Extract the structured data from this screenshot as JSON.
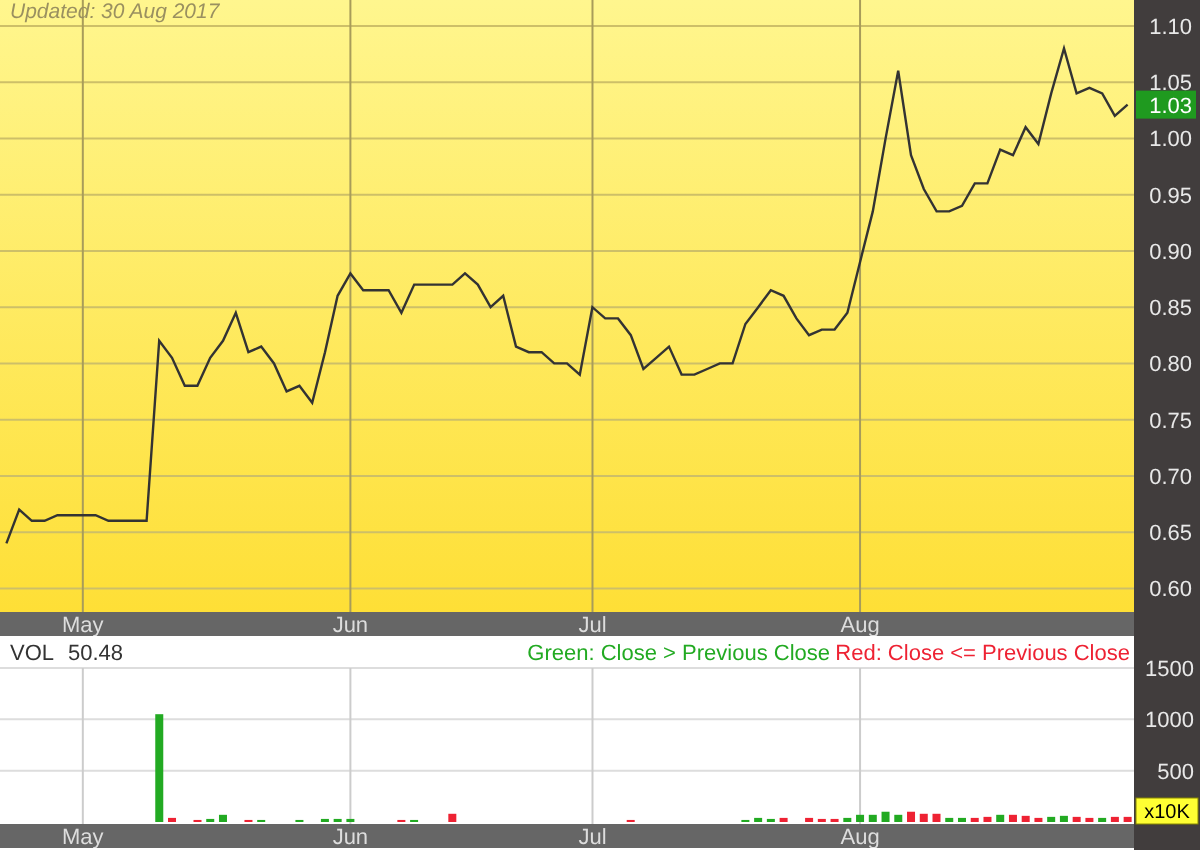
{
  "updated": "Updated: 30 Aug 2017",
  "price_chart": {
    "last_price": "1.03",
    "chart_data": {
      "type": "line",
      "categories": [
        null,
        null,
        null,
        null,
        null,
        null,
        "May",
        null,
        null,
        null,
        null,
        null,
        null,
        null,
        null,
        null,
        null,
        null,
        null,
        null,
        null,
        null,
        null,
        null,
        null,
        null,
        null,
        "Jun",
        null,
        null,
        null,
        null,
        null,
        null,
        null,
        null,
        null,
        null,
        null,
        null,
        null,
        null,
        null,
        null,
        null,
        null,
        "Jul",
        null,
        null,
        null,
        null,
        null,
        null,
        null,
        null,
        null,
        null,
        null,
        null,
        null,
        null,
        null,
        null,
        null,
        null,
        null,
        null,
        "Aug",
        null,
        null,
        null,
        null,
        null,
        null,
        null,
        null,
        null,
        null,
        null,
        null,
        null,
        null,
        null,
        null,
        null,
        null,
        null,
        null,
        null
      ],
      "series": [
        {
          "color": "#333333",
          "values": [
            0.64,
            0.67,
            0.66,
            0.66,
            0.665,
            0.665,
            0.665,
            0.665,
            0.66,
            0.66,
            0.66,
            0.66,
            0.82,
            0.805,
            0.78,
            0.78,
            0.805,
            0.82,
            0.845,
            0.81,
            0.815,
            0.8,
            0.775,
            0.78,
            0.765,
            0.81,
            0.86,
            0.88,
            0.865,
            0.865,
            0.865,
            0.845,
            0.87,
            0.87,
            0.87,
            0.87,
            0.88,
            0.87,
            0.85,
            0.86,
            0.815,
            0.81,
            0.81,
            0.8,
            0.8,
            0.79,
            0.85,
            0.84,
            0.84,
            0.825,
            0.795,
            0.805,
            0.815,
            0.79,
            0.79,
            0.795,
            0.8,
            0.8,
            0.835,
            0.85,
            0.865,
            0.86,
            0.84,
            0.825,
            0.83,
            0.83,
            0.845,
            0.89,
            0.935,
            1.0,
            1.06,
            0.985,
            0.955,
            0.935,
            0.935,
            0.94,
            0.96,
            0.96,
            0.99,
            0.985,
            1.01,
            0.995,
            1.04,
            1.08,
            1.04,
            1.045,
            1.04,
            1.02,
            1.03
          ]
        }
      ],
      "ylim": [
        0.579,
        1.123
      ],
      "grid": true,
      "yticks": [
        {
          "value": 0.6,
          "label": "0.60"
        },
        {
          "value": 0.65,
          "label": "0.65"
        },
        {
          "value": 0.7,
          "label": "0.70"
        },
        {
          "value": 0.75,
          "label": "0.75"
        },
        {
          "value": 0.8,
          "label": "0.80"
        },
        {
          "value": 0.85,
          "label": "0.85"
        },
        {
          "value": 0.9,
          "label": "0.90"
        },
        {
          "value": 0.95,
          "label": "0.95"
        },
        {
          "value": 1.0,
          "label": "1.00"
        },
        {
          "value": 1.05,
          "label": "1.05"
        },
        {
          "value": 1.1,
          "label": "1.10"
        }
      ]
    }
  },
  "volume_chart": {
    "label": "VOL",
    "reading": "50.48",
    "unit": "x10K",
    "chart_data": {
      "type": "bar",
      "categories": [
        null,
        null,
        null,
        null,
        null,
        null,
        "May",
        null,
        null,
        null,
        null,
        null,
        null,
        null,
        null,
        null,
        null,
        null,
        null,
        null,
        null,
        null,
        null,
        null,
        null,
        null,
        null,
        "Jun",
        null,
        null,
        null,
        null,
        null,
        null,
        null,
        null,
        null,
        null,
        null,
        null,
        null,
        null,
        null,
        null,
        null,
        null,
        "Jul",
        null,
        null,
        null,
        null,
        null,
        null,
        null,
        null,
        null,
        null,
        null,
        null,
        null,
        null,
        null,
        null,
        null,
        null,
        null,
        null,
        "Aug",
        null,
        null,
        null,
        null,
        null,
        null,
        null,
        null,
        null,
        null,
        null,
        null,
        null,
        null,
        null,
        null,
        null,
        null,
        null,
        null,
        null
      ],
      "series": [
        {
          "name": "Green: Close > Previous Close",
          "color": "#22aa22",
          "values": [
            null,
            null,
            null,
            null,
            null,
            null,
            null,
            null,
            null,
            null,
            null,
            null,
            1050,
            null,
            null,
            null,
            30,
            70,
            null,
            null,
            20,
            null,
            null,
            20,
            null,
            30,
            30,
            30,
            null,
            null,
            null,
            null,
            20,
            null,
            null,
            null,
            null,
            null,
            null,
            null,
            null,
            null,
            null,
            null,
            null,
            null,
            null,
            null,
            null,
            null,
            null,
            null,
            null,
            null,
            null,
            null,
            null,
            null,
            20,
            40,
            30,
            null,
            null,
            null,
            null,
            null,
            40,
            70,
            70,
            100,
            70,
            null,
            null,
            null,
            40,
            40,
            null,
            null,
            70,
            null,
            null,
            null,
            50,
            60,
            null,
            null,
            40,
            null,
            null
          ]
        },
        {
          "name": "Red: Close <= Previous Close",
          "color": "#ee2233",
          "values": [
            null,
            null,
            null,
            null,
            null,
            null,
            null,
            null,
            null,
            null,
            null,
            null,
            null,
            40,
            null,
            20,
            null,
            null,
            null,
            20,
            null,
            null,
            null,
            null,
            null,
            null,
            null,
            null,
            null,
            null,
            null,
            20,
            null,
            null,
            null,
            80,
            null,
            null,
            null,
            null,
            null,
            null,
            null,
            null,
            null,
            null,
            null,
            null,
            null,
            20,
            null,
            null,
            null,
            null,
            null,
            null,
            null,
            null,
            null,
            null,
            null,
            40,
            null,
            40,
            30,
            30,
            null,
            null,
            null,
            null,
            null,
            100,
            80,
            80,
            null,
            null,
            40,
            50,
            null,
            70,
            60,
            40,
            null,
            null,
            50,
            40,
            null,
            50,
            50
          ]
        }
      ],
      "grid": true,
      "ylim": [
        0,
        1500
      ],
      "yticks": [
        500,
        1000,
        1500
      ]
    }
  }
}
